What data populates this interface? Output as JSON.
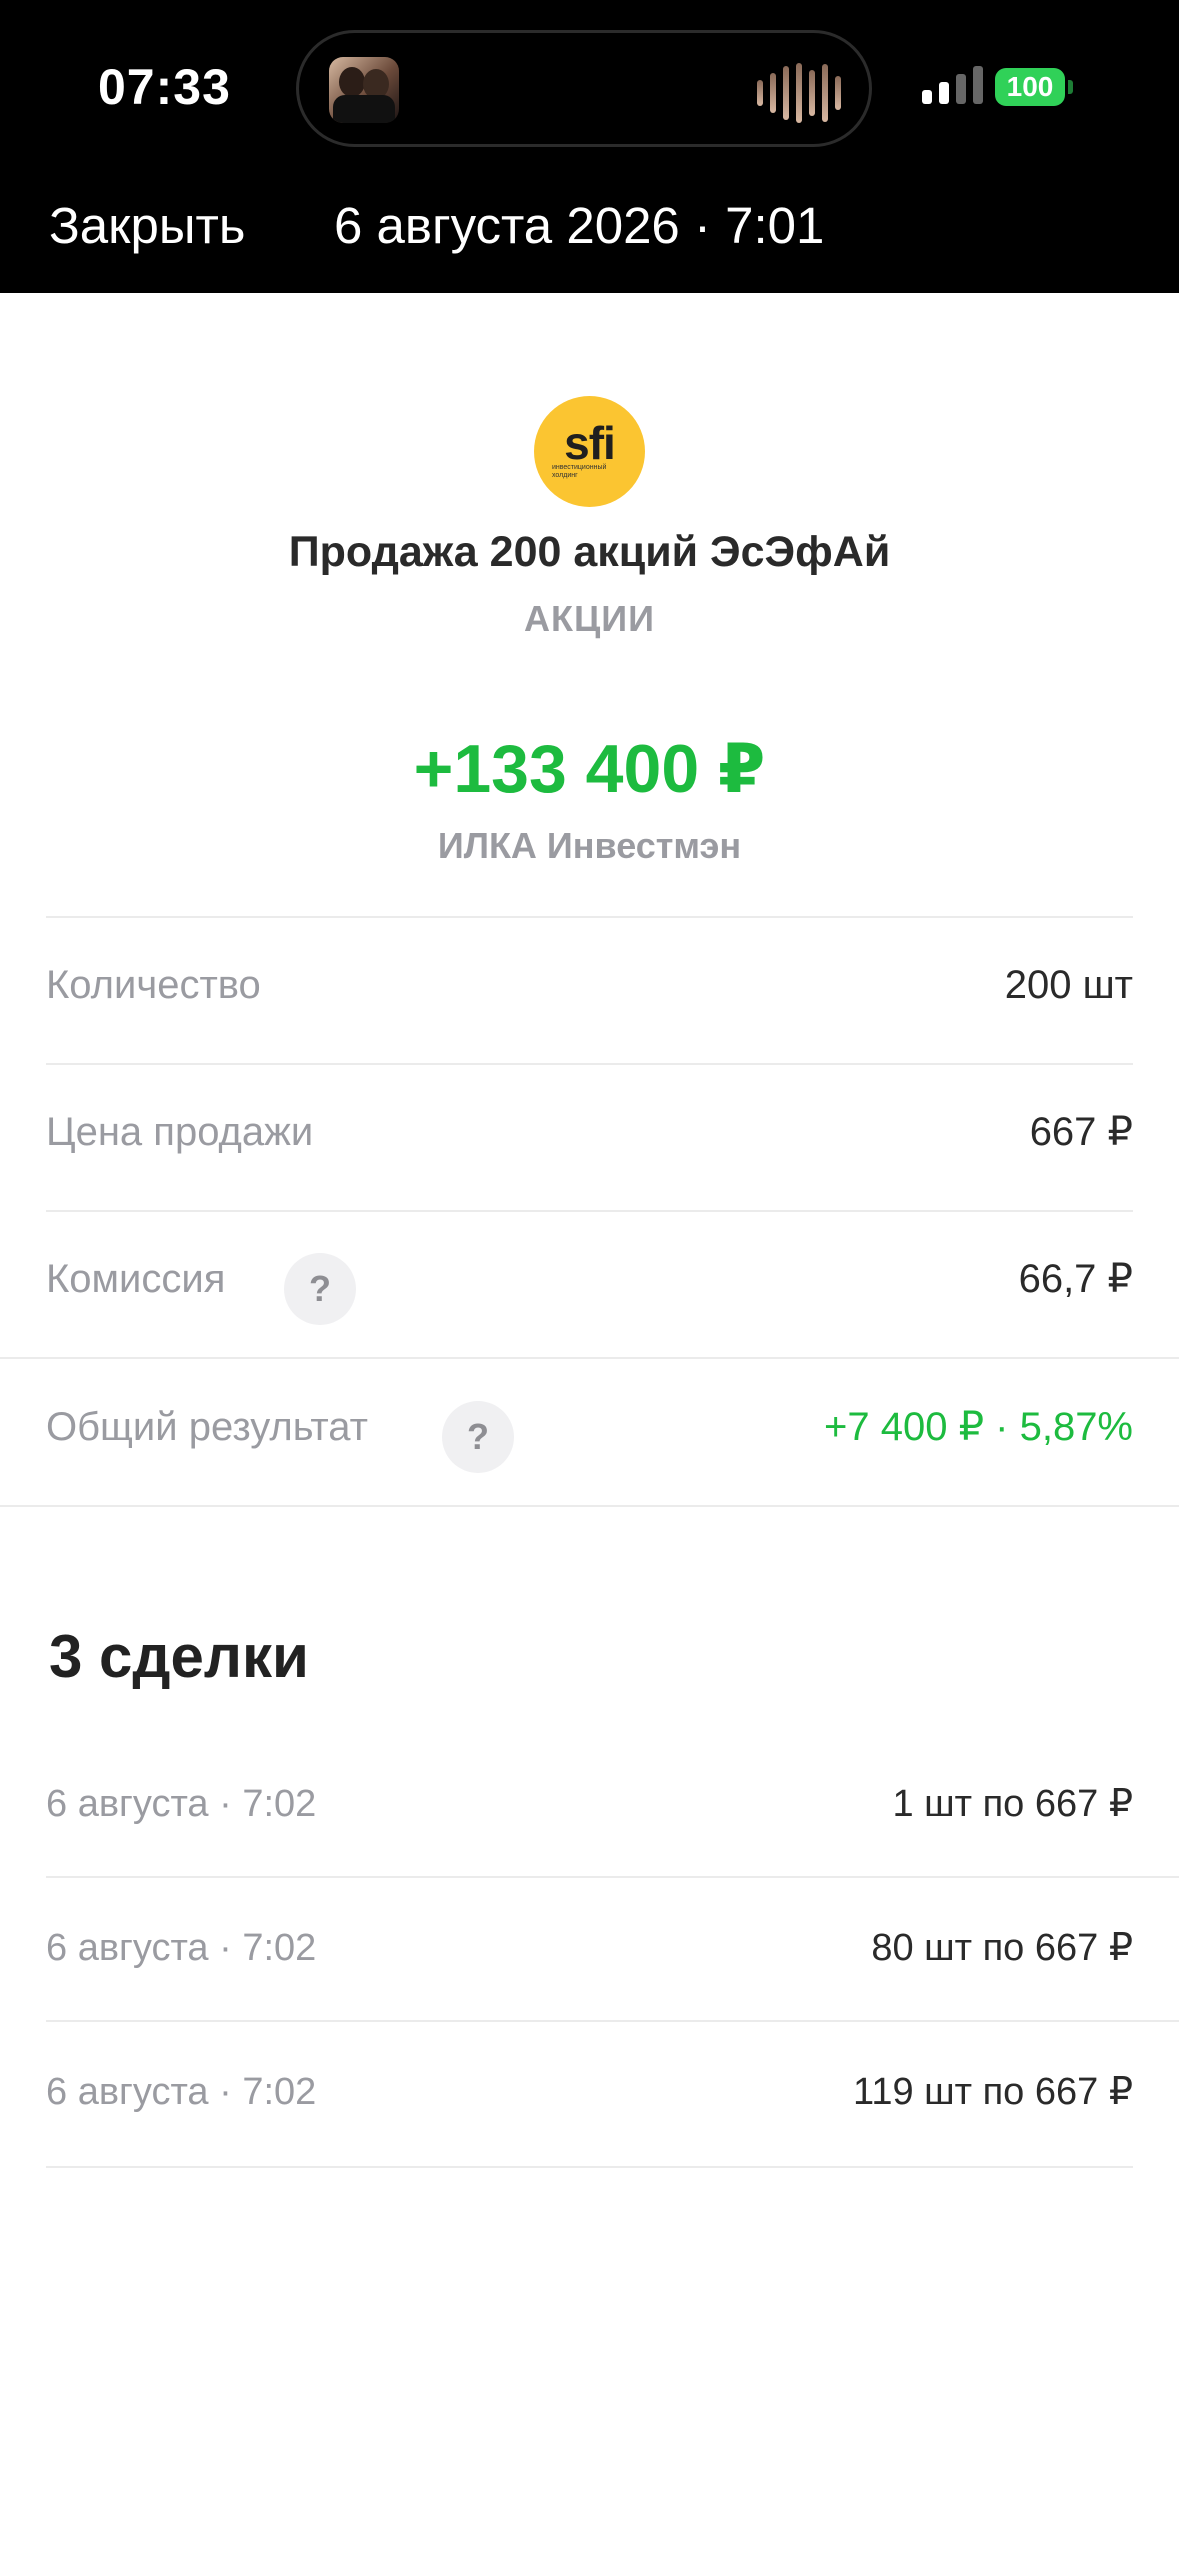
{
  "status_bar": {
    "time": "07:33",
    "battery": "100",
    "battery_color": "#30d158"
  },
  "nav": {
    "close_label": "Закрыть",
    "title": "6 августа 2026 · 7:01"
  },
  "asset": {
    "logo_text": "sfi",
    "logo_sub": "инвестиционный холдинг",
    "logo_color": "#fbc531",
    "title": "Продажа 200 акций ЭсЭфАй",
    "category": "АКЦИИ",
    "amount": "+133 400 ₽",
    "account": "ИЛКА Инвестмэн"
  },
  "details": [
    {
      "label": "Количество",
      "value": "200 шт"
    },
    {
      "label": "Цена продажи",
      "value": "667 ₽"
    },
    {
      "label": "Комиссия",
      "value": "66,7 ₽",
      "help": "?"
    },
    {
      "label": "Общий результат",
      "value": "+7 400 ₽ · 5,87%",
      "help": "?"
    }
  ],
  "deals": {
    "title": "3 сделки",
    "items": [
      {
        "date": "6 августа · 7:02",
        "value": "1 шт по 667 ₽"
      },
      {
        "date": "6 августа · 7:02",
        "value": "80 шт по 667 ₽"
      },
      {
        "date": "6 августа · 7:02",
        "value": "119 шт по 667 ₽"
      }
    ]
  },
  "colors": {
    "accent_green": "#1dbb3f",
    "muted": "#9a9ba1"
  }
}
